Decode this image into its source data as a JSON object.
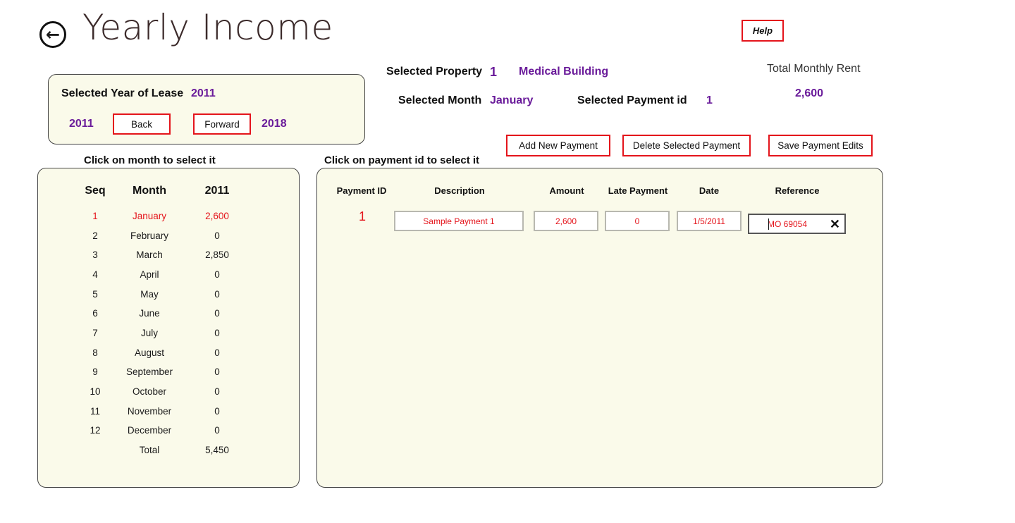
{
  "header": {
    "title": "Yearly Income",
    "help_label": "Help"
  },
  "property": {
    "label": "Selected Property",
    "id": "1",
    "name": "Medical Building",
    "month_label": "Selected Month",
    "month": "January",
    "payment_label": "Selected Payment id",
    "payment_id": "1",
    "rent_label": "Total Monthly Rent",
    "rent": "2,600"
  },
  "lease": {
    "label": "Selected Year of Lease",
    "year": "2011",
    "start_year": "2011",
    "end_year": "2018",
    "back_label": "Back",
    "forward_label": "Forward"
  },
  "actions": {
    "add_label": "Add New Payment",
    "delete_label": "Delete Selected Payment",
    "save_label": "Save Payment Edits"
  },
  "months_panel": {
    "caption": "Click on month to select it",
    "headers": {
      "seq": "Seq",
      "month": "Month",
      "year": "2011"
    },
    "rows": [
      {
        "seq": "1",
        "month": "January",
        "value": "2,600",
        "selected": true
      },
      {
        "seq": "2",
        "month": "February",
        "value": "0"
      },
      {
        "seq": "3",
        "month": "March",
        "value": "2,850"
      },
      {
        "seq": "4",
        "month": "April",
        "value": "0"
      },
      {
        "seq": "5",
        "month": "May",
        "value": "0"
      },
      {
        "seq": "6",
        "month": "June",
        "value": "0"
      },
      {
        "seq": "7",
        "month": "July",
        "value": "0"
      },
      {
        "seq": "8",
        "month": "August",
        "value": "0"
      },
      {
        "seq": "9",
        "month": "September",
        "value": "0"
      },
      {
        "seq": "10",
        "month": "October",
        "value": "0"
      },
      {
        "seq": "11",
        "month": "November",
        "value": "0"
      },
      {
        "seq": "12",
        "month": "December",
        "value": "0"
      }
    ],
    "total_label": "Total",
    "total_value": "5,450"
  },
  "payments_panel": {
    "caption": "Click on payment id to select it",
    "headers": {
      "id": "Payment ID",
      "description": "Description",
      "amount": "Amount",
      "late": "Late Payment",
      "date": "Date",
      "reference": "Reference"
    },
    "row": {
      "id": "1",
      "description": "Sample Payment 1",
      "amount": "2,600",
      "late": "0",
      "date": "1/5/2011",
      "reference": "MO 69054"
    }
  },
  "icons": {
    "back": "back-arrow-circle-icon",
    "clear": "close-icon"
  },
  "colors": {
    "accent": "#6a1b9a",
    "highlight": "#e4141b",
    "panel": "#fafaea"
  }
}
